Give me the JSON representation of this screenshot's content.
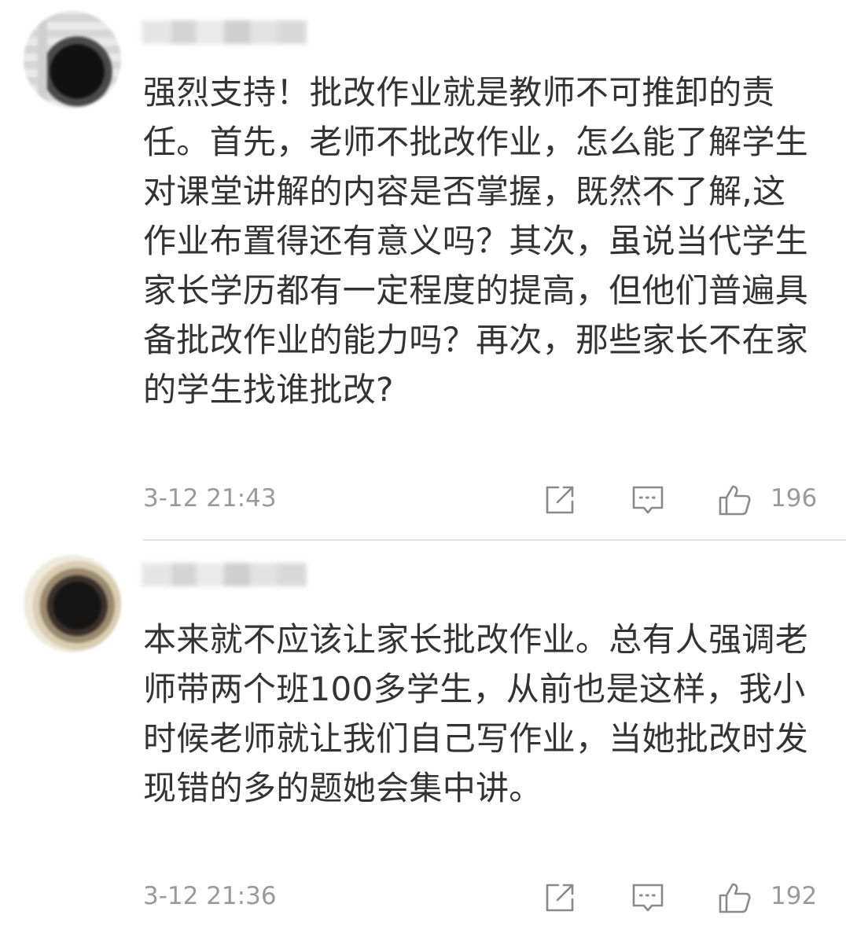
{
  "comments": [
    {
      "text": "强烈支持！批改作业就是教师不可推卸的责任。首先，老师不批改作业，怎么能了解学生对课堂讲解的内容是否掌握，既然不了解,这作业布置得还有意义吗？其次，虽说当代学生家长学历都有一定程度的提高，但他们普遍具备批改作业的能力吗？再次，那些家长不在家的学生找谁批改?",
      "timestamp": "3-12 21:43",
      "likes": "196",
      "icons": [
        "share-icon",
        "reply-icon",
        "thumbs-up-icon"
      ]
    },
    {
      "text": "本来就不应该让家长批改作业。总有人强调老师带两个班100多学生，从前也是这样，我小时候老师就让我们自己写作业，当她批改时发现错的多的题她会集中讲。",
      "timestamp": "3-12 21:36",
      "likes": "192",
      "icons": [
        "share-icon",
        "reply-icon",
        "thumbs-up-icon"
      ]
    }
  ],
  "colors": {
    "text": "#333333",
    "meta": "#9a9a9a",
    "icon": "#8a8a8a",
    "divider": "#e2e2e2"
  }
}
